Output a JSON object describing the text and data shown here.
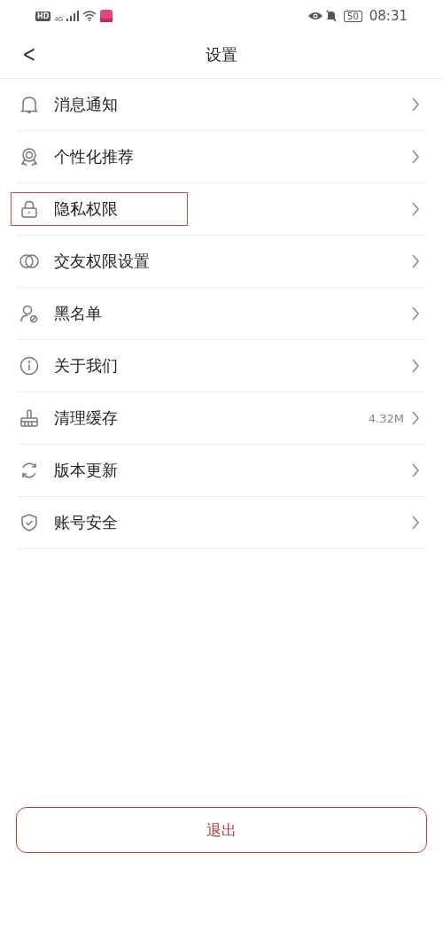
{
  "status_bar": {
    "hd": "HD",
    "network": "4G",
    "battery": "50",
    "time": "08:31"
  },
  "header": {
    "back": "<",
    "title": "设置"
  },
  "items": [
    {
      "kind": "bell",
      "label": "消息通知",
      "highlighted": false
    },
    {
      "kind": "medal",
      "label": "个性化推荐",
      "highlighted": false
    },
    {
      "kind": "lock",
      "label": "隐私权限",
      "highlighted": true
    },
    {
      "kind": "circles",
      "label": "交友权限设置",
      "highlighted": false
    },
    {
      "kind": "user-block",
      "label": "黑名单",
      "highlighted": false
    },
    {
      "kind": "info",
      "label": "关于我们",
      "highlighted": false
    },
    {
      "kind": "broom",
      "label": "清理缓存",
      "value": "4.32M",
      "highlighted": false
    },
    {
      "kind": "refresh",
      "label": "版本更新",
      "highlighted": false
    },
    {
      "kind": "shield",
      "label": "账号安全",
      "highlighted": false
    }
  ],
  "logout": "退出"
}
